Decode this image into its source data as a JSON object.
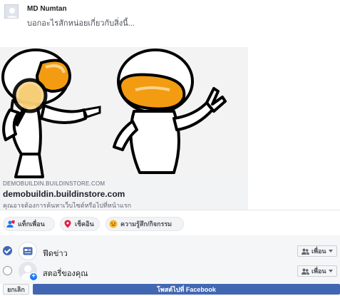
{
  "composer": {
    "user_name": "MD Numtan",
    "placeholder": "บอกอะไรสักหน่อยเกี่ยวกับสิ่งนี้..."
  },
  "link_preview": {
    "domain": "DEMOBUILDIN.BUILDINSTORE.COM",
    "title": "demobuildin.buildinstore.com",
    "description": "คุณอาจต้องการค้นหาเว็บไซต์หรือไปที่หน้าแรก"
  },
  "actions": {
    "tag_friends": "แท็กเพื่อน",
    "check_in": "เช็คอิน",
    "feeling_activity": "ความรู้สึก/กิจกรรม"
  },
  "audience": {
    "rows": [
      {
        "label": "ฟีดข่าว",
        "privacy": "เพื่อน",
        "checked": true,
        "icon": "news-feed-icon"
      },
      {
        "label": "สตอรี่ของคุณ",
        "privacy": "เพื่อน",
        "checked": false,
        "icon": "story-icon"
      }
    ]
  },
  "footer": {
    "cancel_label": "ยกเลิก",
    "post_label": "โพสต์ไปที่ Facebook"
  },
  "colors": {
    "accent": "#4267b2",
    "checkin_pin": "#e41e3f",
    "feeling_face": "#f7b928",
    "tag_icon": "#1877f2"
  }
}
